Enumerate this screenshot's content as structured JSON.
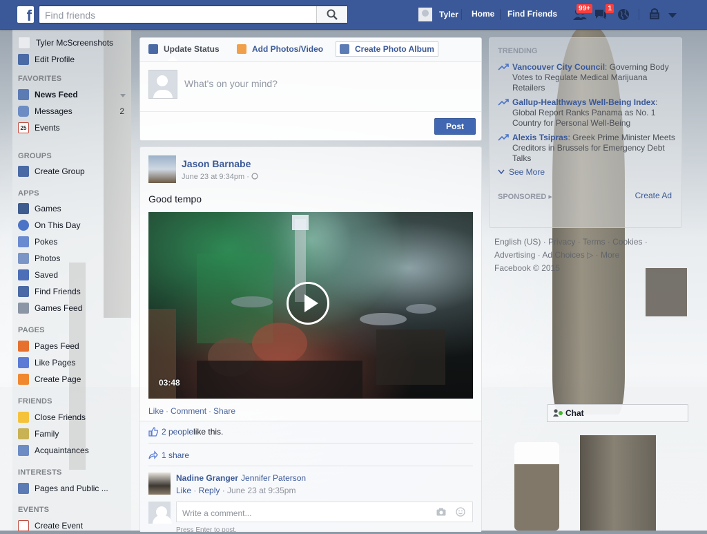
{
  "topbar": {
    "logo": "f",
    "search_placeholder": "Find friends",
    "user_name": "Tyler",
    "nav_home": "Home",
    "nav_find_friends": "Find Friends",
    "friend_requests_badge": "99+",
    "messages_badge": "1"
  },
  "left": {
    "profile_name": "Tyler McScreenshots",
    "edit_profile": "Edit Profile",
    "favorites_header": "FAVORITES",
    "favorites": [
      {
        "label": "News Feed",
        "count": ""
      },
      {
        "label": "Messages",
        "count": "2"
      },
      {
        "label": "Events",
        "count": "",
        "icon_text": "25"
      }
    ],
    "groups_header": "GROUPS",
    "create_group": "Create Group",
    "apps_header": "APPS",
    "apps": [
      "Games",
      "On This Day",
      "Pokes",
      "Photos",
      "Saved",
      "Find Friends",
      "Games Feed"
    ],
    "pages_header": "PAGES",
    "pages": [
      "Pages Feed",
      "Like Pages",
      "Create Page"
    ],
    "friends_header": "FRIENDS",
    "friends": [
      "Close Friends",
      "Family",
      "Acquaintances"
    ],
    "interests_header": "INTERESTS",
    "interests": [
      "Pages and Public ..."
    ],
    "events_header": "EVENTS",
    "events": [
      "Create Event"
    ]
  },
  "composer": {
    "tab_update_status": "Update Status",
    "tab_add_photos": "Add Photos/Video",
    "tab_create_album": "Create Photo Album",
    "prompt": "What's on your mind?",
    "post_button": "Post"
  },
  "story": {
    "author": "Jason Barnabe",
    "time": "June 23 at 9:34pm",
    "privacy_glyph": "·",
    "text": "Good tempo",
    "video_duration": "03:48",
    "action_like": "Like",
    "action_comment": "Comment",
    "action_share": "Share",
    "likes_link": "2 people",
    "likes_suffix": " like this.",
    "shares": "1 share",
    "comment": {
      "author": "Nadine Granger",
      "text": "Jennifer Paterson",
      "like": "Like",
      "reply": "Reply",
      "time": "June 23 at 9:35pm"
    },
    "comment_placeholder": "Write a comment...",
    "press_enter": "Press Enter to post."
  },
  "right": {
    "trending_header": "TRENDING",
    "trends": [
      {
        "title": "Vancouver City Council",
        "text": ": Governing Body Votes to Regulate Medical Marijuana Retailers"
      },
      {
        "title": "Gallup-Healthways Well-Being Index",
        "text": ": Global Report Ranks Panama as No. 1 Country for Personal Well-Being"
      },
      {
        "title": "Alexis Tsipras",
        "text": ": Greek Prime Minister Meets Creditors in Brussels for Emergency Debt Talks"
      }
    ],
    "see_more": "See More",
    "sponsored_header": "SPONSORED",
    "create_ad": "Create Ad",
    "footer_line1": "English (US) · Privacy · Terms · Cookies ·",
    "footer_line2": "Advertising · Ad Choices ▷ · More",
    "footer_line3": "Facebook © 2015"
  },
  "chat": {
    "label": "Chat"
  },
  "colors": {
    "brand": "#3b5998",
    "link": "#3b5998",
    "badge": "#fa3e3e",
    "post_button": "#4267b2"
  }
}
